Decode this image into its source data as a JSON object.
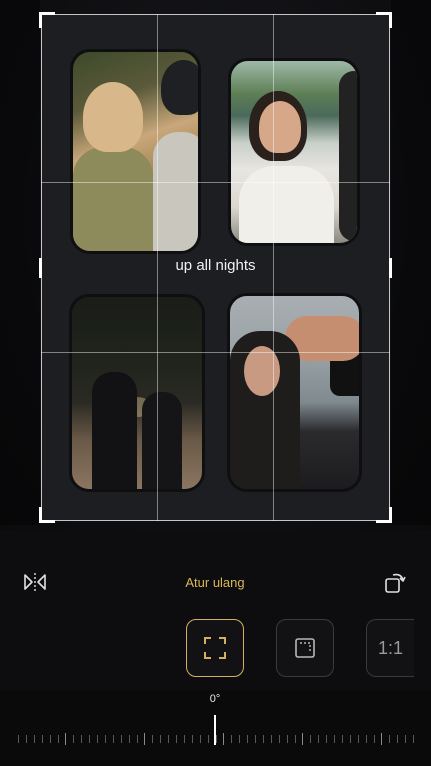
{
  "editor": {
    "caption": "up all nights",
    "reset_label": "Atur ulang",
    "ratio_label": "1:1",
    "rotation_degree": "0°",
    "accent_color": "#d2b060"
  },
  "icons": {
    "mirror": "flip-horizontal-icon",
    "rotate": "rotate-icon",
    "freeform": "crop-freeform-icon",
    "original": "crop-original-icon"
  }
}
